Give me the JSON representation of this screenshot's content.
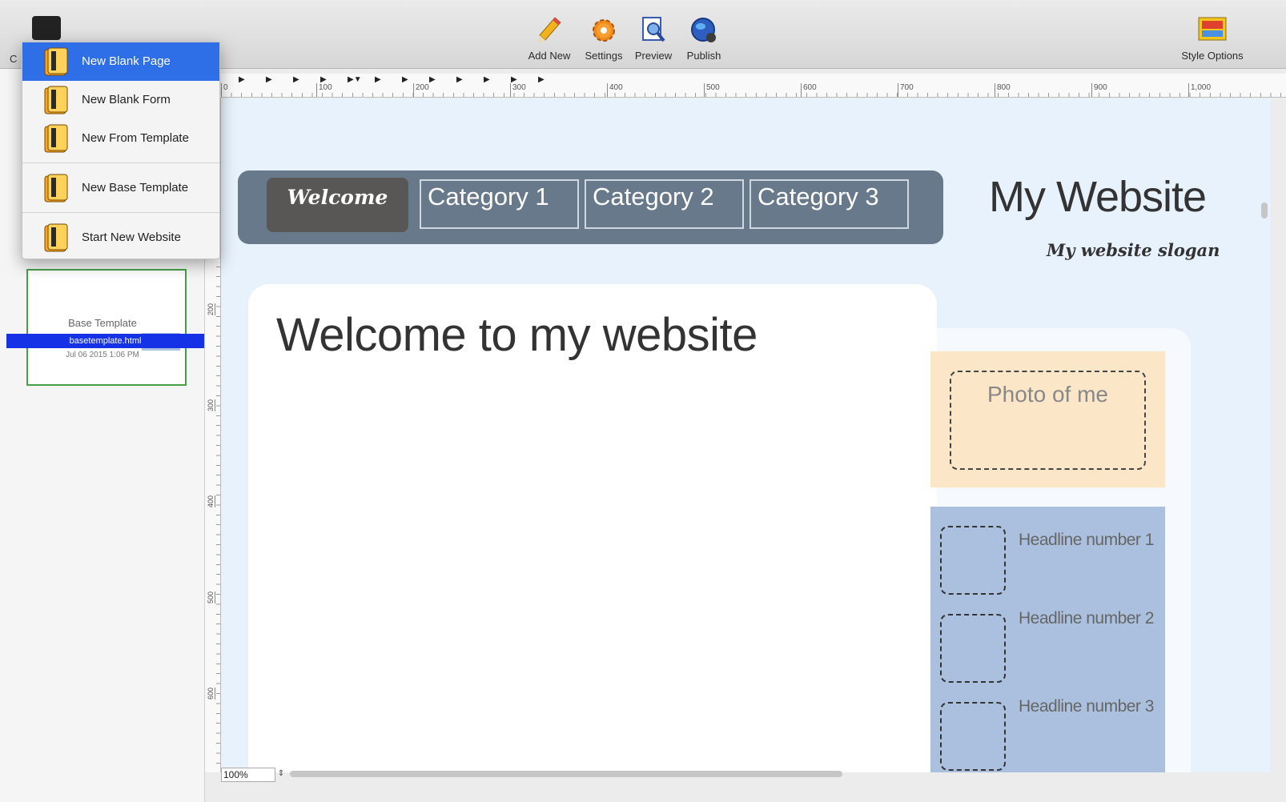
{
  "toolbar": {
    "left_stub": "C",
    "buttons": [
      {
        "label": "Add New",
        "icon": "pencil-icon"
      },
      {
        "label": "Settings",
        "icon": "gear-icon"
      },
      {
        "label": "Preview",
        "icon": "preview-icon"
      },
      {
        "label": "Publish",
        "icon": "globe-icon"
      }
    ],
    "style_options": {
      "label": "Style Options",
      "icon": "style-options-icon"
    }
  },
  "menu": {
    "items": [
      {
        "label": "New Blank Page",
        "selected": true
      },
      {
        "label": "New Blank Form"
      },
      {
        "label": "New From Template"
      },
      {
        "label": "New Base Template"
      },
      {
        "label": "Start New Website"
      }
    ]
  },
  "sidebar": {
    "page_label": "Base Template",
    "file_name": "basetemplate.html",
    "date": "Jul 06 2015 1:06 PM"
  },
  "rulers": {
    "horizontal": [
      "0",
      "100",
      "200",
      "300",
      "400",
      "500",
      "600",
      "700",
      "800",
      "900",
      "1,000"
    ],
    "vertical": [
      "200",
      "300",
      "400",
      "500",
      "600"
    ]
  },
  "canvas": {
    "nav": {
      "welcome": "Welcome",
      "categories": [
        "Category 1",
        "Category 2",
        "Category 3"
      ]
    },
    "site_title": "My Website",
    "site_slogan": "My website slogan",
    "content_heading": "Welcome to my website",
    "photo_label": "Photo of me",
    "headlines": [
      "Headline number 1",
      "Headline number 2",
      "Headline number 3"
    ]
  },
  "bottom": {
    "zoom": "100%"
  },
  "colors": {
    "nav_bg": "#67798a",
    "welcome_bg": "#585756",
    "canvas_bg": "#e8f2fc",
    "photo_bg": "#fbe6c8",
    "news_bg": "#aac0de",
    "menu_selected": "#2e6ee6"
  }
}
